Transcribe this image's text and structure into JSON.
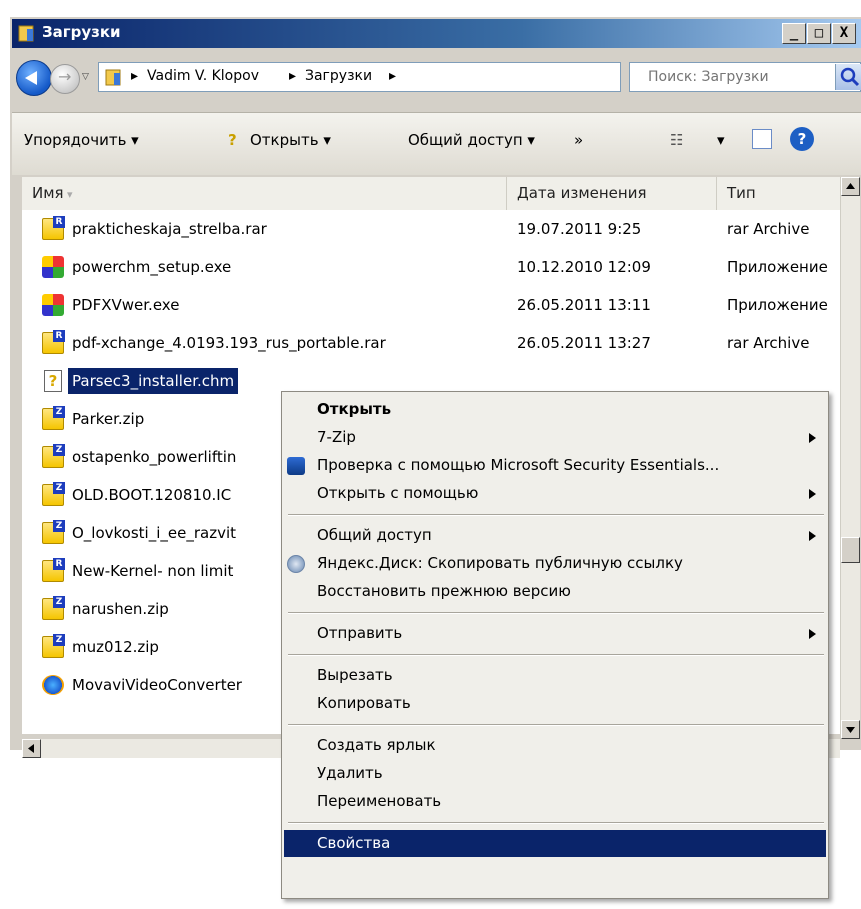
{
  "window": {
    "title": "Загрузки",
    "controls": [
      "_",
      "□",
      "X"
    ]
  },
  "address": {
    "crumbs": [
      "Vadim V. Klopov",
      "Загрузки"
    ],
    "search_placeholder": "Поиск: Загрузки"
  },
  "toolbar": {
    "organize": "Упорядочить ▾",
    "open": "Открыть ▾",
    "share": "Общий доступ ▾",
    "more": "»"
  },
  "columns": {
    "name": "Имя",
    "date": "Дата изменения",
    "type": "Тип"
  },
  "files": [
    {
      "name": "prakticheskaja_strelba.rar",
      "date": "19.07.2011 9:25",
      "type": "rar Archive",
      "icon": "rar-archive-icon"
    },
    {
      "name": "powerchm_setup.exe",
      "date": "10.12.2010 12:09",
      "type": "Приложение",
      "icon": "application-icon"
    },
    {
      "name": "PDFXVwer.exe",
      "date": "26.05.2011 13:11",
      "type": "Приложение",
      "icon": "application-icon"
    },
    {
      "name": "pdf-xchange_4.0193.193_rus_portable.rar",
      "date": "26.05.2011 13:27",
      "type": "rar Archive",
      "icon": "rar-archive-icon"
    },
    {
      "name": "Parsec3_installer.chm",
      "date": "",
      "type": "",
      "icon": "chm-help-icon",
      "selected": true
    },
    {
      "name": "Parker.zip",
      "date": "",
      "type": "",
      "icon": "zip-archive-icon"
    },
    {
      "name": "ostapenko_powerliftin",
      "date": "",
      "type": "",
      "icon": "zip-archive-icon"
    },
    {
      "name": "OLD.BOOT.120810.IC",
      "date": "",
      "type": "",
      "icon": "zip-archive-icon"
    },
    {
      "name": "O_lovkosti_i_ee_razvit",
      "date": "",
      "type": "",
      "icon": "zip-archive-icon"
    },
    {
      "name": "New-Kernel- non limit",
      "date": "",
      "type": "",
      "icon": "rar-archive-icon"
    },
    {
      "name": "narushen.zip",
      "date": "",
      "type": "",
      "icon": "zip-archive-icon"
    },
    {
      "name": "muz012.zip",
      "date": "",
      "type": "",
      "icon": "zip-archive-icon"
    },
    {
      "name": "MovaviVideoConverter",
      "date": "",
      "type": "",
      "icon": "movavi-app-icon"
    }
  ],
  "context_menu": [
    {
      "label": "Открыть",
      "bold": true
    },
    {
      "label": "7-Zip",
      "submenu": true
    },
    {
      "label": "Проверка с помощью Microsoft Security Essentials...",
      "icon": "mse-icon"
    },
    {
      "label": "Открыть с помощью",
      "submenu": true
    },
    {
      "separator": true
    },
    {
      "label": "Общий доступ",
      "submenu": true
    },
    {
      "label": "Яндекс.Диск: Скопировать публичную ссылку",
      "icon": "yandex-disk-icon"
    },
    {
      "label": "Восстановить прежнюю версию"
    },
    {
      "separator": true
    },
    {
      "label": "Отправить",
      "submenu": true
    },
    {
      "separator": true
    },
    {
      "label": "Вырезать"
    },
    {
      "label": "Копировать"
    },
    {
      "separator": true
    },
    {
      "label": "Создать ярлык"
    },
    {
      "label": "Удалить"
    },
    {
      "label": "Переименовать"
    },
    {
      "separator": true
    },
    {
      "label": "Свойства",
      "highlighted": true
    }
  ]
}
